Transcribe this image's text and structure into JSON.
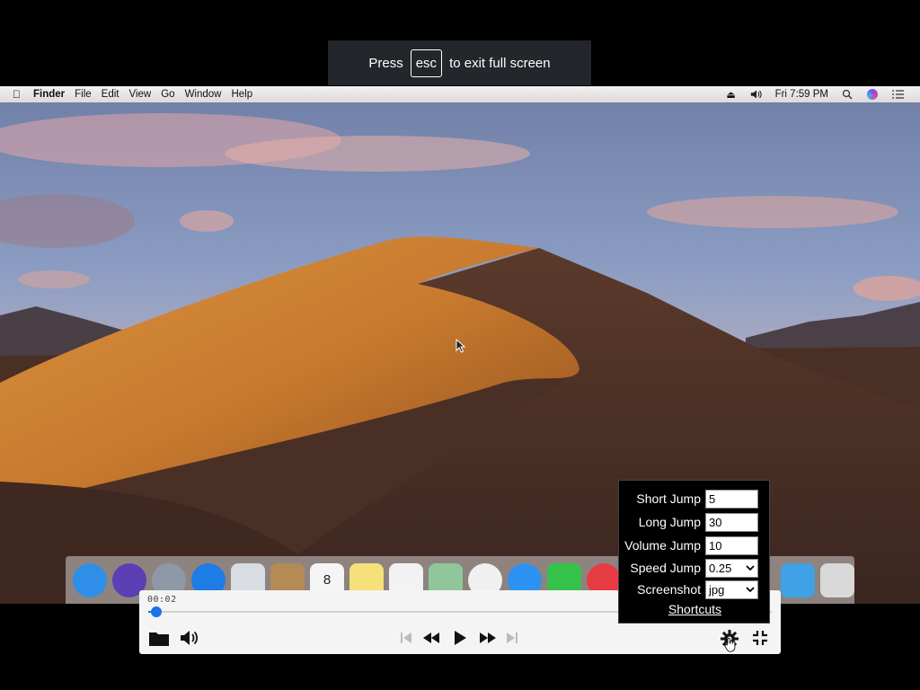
{
  "fullscreen_toast": {
    "press": "Press",
    "key": "esc",
    "rest": "to exit full screen"
  },
  "menubar": {
    "apple_icon": "apple-icon",
    "items": [
      "Finder",
      "File",
      "Edit",
      "View",
      "Go",
      "Window",
      "Help"
    ],
    "clock": "Fri 7:59 PM",
    "status_icons": [
      "eject-icon",
      "volume-icon",
      "search-icon",
      "siri-icon",
      "list-icon"
    ]
  },
  "dock": {
    "apps": [
      {
        "name": "Finder",
        "color": "#2f8fe8"
      },
      {
        "name": "Siri",
        "color": "#5b3fb5"
      },
      {
        "name": "Launchpad",
        "color": "#8d9aa6"
      },
      {
        "name": "Safari",
        "color": "#1e7de4"
      },
      {
        "name": "Mail",
        "color": "#d7dde3"
      },
      {
        "name": "Contacts",
        "color": "#b48a55"
      },
      {
        "name": "Calendar",
        "color": "#f5f5f5",
        "text": "8"
      },
      {
        "name": "Notes",
        "color": "#f6e07a"
      },
      {
        "name": "Reminders",
        "color": "#f2f2f2"
      },
      {
        "name": "Maps",
        "color": "#8fc79a"
      },
      {
        "name": "Photos",
        "color": "#f0f0f0"
      },
      {
        "name": "Messages",
        "color": "#2d92f2"
      },
      {
        "name": "FaceTime",
        "color": "#36c14b"
      },
      {
        "name": "News",
        "color": "#e83c45"
      }
    ],
    "right_apps": [
      {
        "name": "Downloads",
        "color": "#3fa2e6"
      },
      {
        "name": "Trash",
        "color": "#d9d9d9"
      }
    ]
  },
  "player": {
    "current_time": "00:02",
    "progress_fraction": 0.018,
    "colors": {
      "accent": "#1a73e8"
    },
    "buttons": {
      "open": "folder-icon",
      "volume": "volume-icon",
      "skip_back": "skip-previous-icon",
      "rewind": "rewind-icon",
      "play": "play-icon",
      "fast_forward": "fast-forward-icon",
      "skip_forward": "skip-next-icon",
      "settings": "gear-icon",
      "exit_fullscreen": "exit-fullscreen-icon"
    }
  },
  "settings": {
    "short_jump": {
      "label": "Short Jump",
      "value": "5"
    },
    "long_jump": {
      "label": "Long Jump",
      "value": "30"
    },
    "volume_jump": {
      "label": "Volume Jump",
      "value": "10"
    },
    "speed_jump": {
      "label": "Speed Jump",
      "value": "0.25"
    },
    "screenshot": {
      "label": "Screenshot",
      "value": "jpg"
    },
    "shortcuts": "Shortcuts"
  }
}
